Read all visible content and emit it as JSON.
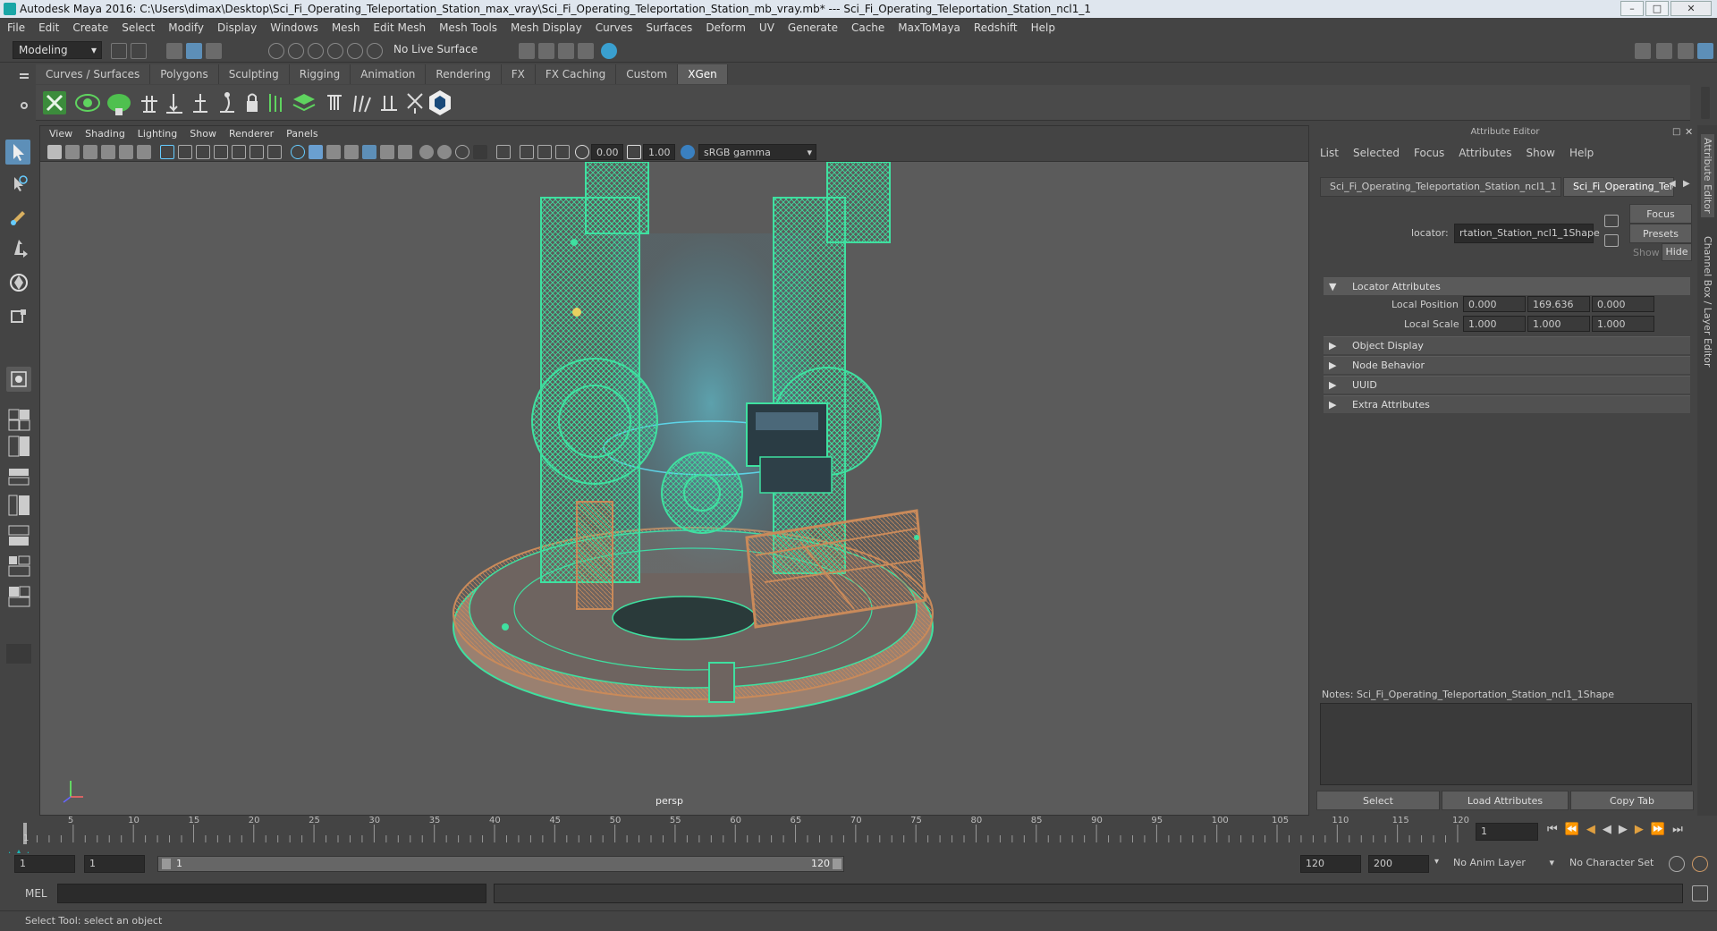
{
  "titlebar": {
    "title": "Autodesk Maya 2016: C:\\Users\\dimax\\Desktop\\Sci_Fi_Operating_Teleportation_Station_max_vray\\Sci_Fi_Operating_Teleportation_Station_mb_vray.mb*   ---   Sci_Fi_Operating_Teleportation_Station_ncl1_1"
  },
  "menubar": [
    "File",
    "Edit",
    "Create",
    "Select",
    "Modify",
    "Display",
    "Windows",
    "Mesh",
    "Edit Mesh",
    "Mesh Tools",
    "Mesh Display",
    "Curves",
    "Surfaces",
    "Deform",
    "UV",
    "Generate",
    "Cache",
    "MaxToMaya",
    "Redshift",
    "Help"
  ],
  "statusline": {
    "mode": "Modeling",
    "live_surface": "No Live Surface"
  },
  "shelf_tabs": [
    {
      "label": "Curves / Surfaces",
      "active": false
    },
    {
      "label": "Polygons",
      "active": false
    },
    {
      "label": "Sculpting",
      "active": false
    },
    {
      "label": "Rigging",
      "active": false
    },
    {
      "label": "Animation",
      "active": false
    },
    {
      "label": "Rendering",
      "active": false
    },
    {
      "label": "FX",
      "active": false
    },
    {
      "label": "FX Caching",
      "active": false
    },
    {
      "label": "Custom",
      "active": false
    },
    {
      "label": "XGen",
      "active": true
    }
  ],
  "viewport": {
    "menu": [
      "View",
      "Shading",
      "Lighting",
      "Show",
      "Renderer",
      "Panels"
    ],
    "exposure": "0.00",
    "gamma": "1.00",
    "colorspace": "sRGB gamma",
    "camera_label": "persp"
  },
  "attribute_editor": {
    "title": "Attribute Editor",
    "menu": [
      "List",
      "Selected",
      "Focus",
      "Attributes",
      "Show",
      "Help"
    ],
    "tabs": [
      "Sci_Fi_Operating_Teleportation_Station_ncl1_1",
      "Sci_Fi_Operating_Tele"
    ],
    "locator_label": "locator:",
    "locator_value": "rtation_Station_ncl1_1Shape",
    "focus_btn": "Focus",
    "presets_btn": "Presets",
    "show_label": "Show",
    "hide_btn": "Hide",
    "section_locator": "Locator Attributes",
    "local_position_label": "Local Position",
    "local_position": [
      "0.000",
      "169.636",
      "0.000"
    ],
    "local_scale_label": "Local Scale",
    "local_scale": [
      "1.000",
      "1.000",
      "1.000"
    ],
    "sections": [
      "Object Display",
      "Node Behavior",
      "UUID",
      "Extra Attributes"
    ],
    "notes": "Notes:  Sci_Fi_Operating_Teleportation_Station_ncl1_1Shape",
    "bottom_buttons": [
      "Select",
      "Load Attributes",
      "Copy Tab"
    ],
    "side_tabs": [
      "Attribute Editor",
      "Channel Box / Layer Editor"
    ]
  },
  "timeline": {
    "ticks": [
      "5",
      "10",
      "15",
      "20",
      "25",
      "30",
      "35",
      "40",
      "45",
      "50",
      "55",
      "60",
      "65",
      "70",
      "75",
      "80",
      "85",
      "90",
      "95",
      "100",
      "105",
      "110",
      "115",
      "120"
    ],
    "start_marker": "1",
    "current_frame": "1"
  },
  "range": {
    "start": "1",
    "playback_start": "1",
    "slider_start": "1",
    "slider_end": "120",
    "playback_end": "120",
    "end": "200",
    "anim_layer": "No Anim Layer",
    "character_set": "No Character Set"
  },
  "cmdline": {
    "label": "MEL"
  },
  "helpline": {
    "text": "Select Tool: select an object"
  },
  "colors": {
    "wire_green": "#3fe0a0",
    "wire_orange": "#c98a5a",
    "accent": "#5d8fb8"
  }
}
